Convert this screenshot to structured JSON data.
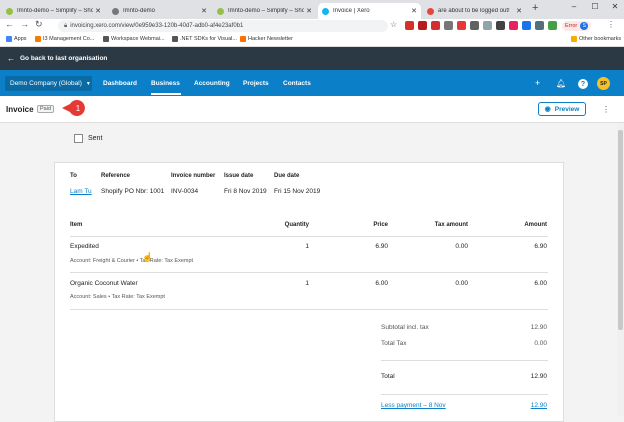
{
  "browser": {
    "tabs": [
      {
        "label": "Imnto-demo – Simplify – Shopify",
        "color": "#96bf48"
      },
      {
        "label": "Imnto-demo",
        "color": "#777777"
      },
      {
        "label": "Imnto-demo – Simplify – Shopify",
        "color": "#96bf48"
      },
      {
        "label": "Invoice | Xero",
        "color": "#13b5ea"
      },
      {
        "label": "are about to be logged out!",
        "color": "#e8453c"
      }
    ],
    "new_tab": "+",
    "url": "invoicing.xero.com/view/0e959e33-120b-40d7-adb0-af4e23af0b1",
    "error_label": "Error",
    "profile_initial": "S",
    "bookmarks": [
      "Apps",
      "I3 Management Co...",
      "Workspace Webmai...",
      ".NET SDKs for Visual...",
      "Hacker Newsletter"
    ],
    "other_bookmarks": "Other bookmarks"
  },
  "xero": {
    "back_label": "Go back to last organisation",
    "org_name": "Demo Company (Global)",
    "nav": [
      "Dashboard",
      "Business",
      "Accounting",
      "Projects",
      "Contacts"
    ],
    "avatar_initials": "SP"
  },
  "page": {
    "title": "Invoice",
    "status_badge": "Paid",
    "step_number": "1",
    "preview_label": "Preview",
    "sent_label": "Sent"
  },
  "invoice": {
    "headers": {
      "to": "To",
      "reference": "Reference",
      "number": "Invoice number",
      "issue": "Issue date",
      "due": "Due date"
    },
    "to": "Lam Tu",
    "reference": "Shopify PO Nbr: 1001",
    "number": "INV-0034",
    "issue_date": "Fri 8 Nov 2019",
    "due_date": "Fri 15 Nov 2019",
    "columns": {
      "item": "Item",
      "quantity": "Quantity",
      "price": "Price",
      "tax": "Tax amount",
      "amount": "Amount"
    },
    "lines": [
      {
        "name": "Expedited",
        "detail": "Account: Freight & Courier • Tax Rate: Tax Exempt",
        "qty": "1",
        "price": "6.90",
        "tax": "0.00",
        "amount": "6.90"
      },
      {
        "name": "Organic Coconut Water",
        "detail": "Account: Sales • Tax Rate: Tax Exempt",
        "qty": "1",
        "price": "6.00",
        "tax": "0.00",
        "amount": "6.00"
      }
    ],
    "subtotal_label": "Subtotal incl. tax",
    "subtotal": "12.90",
    "total_tax_label": "Total Tax",
    "total_tax": "0.00",
    "total_label": "Total",
    "total": "12.90",
    "payment_label": "Less payment – 8 Nov",
    "payment": "12.90"
  },
  "colors": {
    "nav_blue": "#0b7fc7",
    "header_dark": "#2b3945",
    "step_red": "#e53935"
  }
}
